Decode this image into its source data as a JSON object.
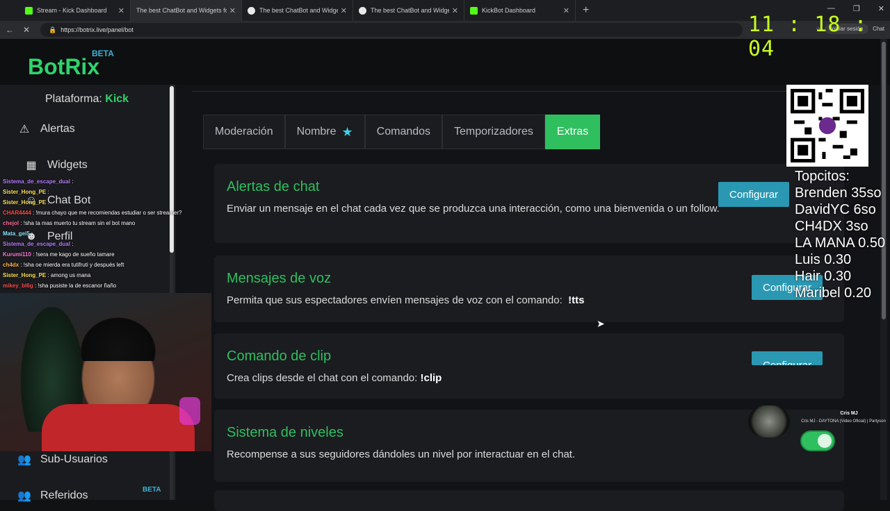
{
  "browser": {
    "tabs": [
      {
        "title": "Stream - Kick Dashboard",
        "color": "#53fc18"
      },
      {
        "title": "The best ChatBot and Widgets for",
        "color": "#e8e8e8"
      },
      {
        "title": "The best ChatBot and Widgets for",
        "color": "#e8e8e8"
      },
      {
        "title": "The best ChatBot and Widgets for",
        "color": "#e8e8e8"
      },
      {
        "title": "KickBot Dashboard",
        "color": "#53fc18"
      }
    ],
    "url": "https://botrix.live/panel/bot",
    "signin_label": "Iniciar sesión",
    "chat_label": "Chat"
  },
  "overlay": {
    "clock": "11 : 18 : 04",
    "topcitos": [
      "Topcitos:",
      "Brenden 35so",
      "DavidYC 6so",
      "CH4DX 3so",
      "LA MANA 0.50",
      "Luis 0.30",
      "Hair 0.30",
      "Maribel 0.20"
    ],
    "music": {
      "artist": "Cris MJ",
      "song": "Cris MJ - DAYTONA (Video Oficial) | Partyson"
    },
    "chat": [
      {
        "user": "Sistema_de_escape_dual",
        "msg": ":",
        "color": "#b57cff"
      },
      {
        "user": "Sister_Hong_PE",
        "msg": ":",
        "color": "#ffe35b"
      },
      {
        "user": "Sister_Hong_PE",
        "msg": ":",
        "color": "#ffe35b"
      },
      {
        "user": "CHAR4444",
        "msg": ": !mura chayo que me recomiendas estudiar o ser streamer?",
        "color": "#ff4b4b"
      },
      {
        "user": "chejol",
        "msg": ": !sha ta mas muerto tu stream sin el bot mano",
        "color": "#ff6a9a"
      },
      {
        "user": "Mata_gei5",
        "msg": ":",
        "color": "#8ee3ff"
      },
      {
        "user": "Sistema_de_escape_dual",
        "msg": ":",
        "color": "#b57cff"
      },
      {
        "user": "Kurumi110",
        "msg": ": !sera me kago de sueño tamare",
        "color": "#ff7ad9"
      },
      {
        "user": "ch4dx",
        "msg": ": !sha oe mierda era tutifruti y después left",
        "color": "#ffb347"
      },
      {
        "user": "Sister_Hong_PE",
        "msg": ": among us mana",
        "color": "#ffe35b"
      },
      {
        "user": "mikey_bl6g",
        "msg": ": !sha pusiste la de escanor ñaño",
        "color": "#ff4b4b"
      }
    ]
  },
  "app": {
    "logo": "BotRix",
    "logo_beta": "BETA",
    "platform_label": "Plataforma:",
    "platform_value": "Kick",
    "sidebar": [
      {
        "label": "Alertas",
        "icon": "warning-icon"
      },
      {
        "label": "Widgets",
        "icon": "widgets-icon"
      },
      {
        "label": "Chat Bot",
        "icon": "robot-icon"
      },
      {
        "label": "Perfil",
        "icon": "user-icon"
      },
      {
        "label": "Sub-Usuarios",
        "icon": "users-icon"
      },
      {
        "label": "Referidos",
        "icon": "users-icon"
      }
    ],
    "referidos_beta": "BETA",
    "tabs": [
      "Moderación",
      "Nombre",
      "Comandos",
      "Temporizadores",
      "Extras"
    ],
    "active_tab": "Extras",
    "cards": [
      {
        "title": "Alertas de chat",
        "desc": "Enviar un mensaje en el chat cada vez que se produzca una interacción, como una bienvenida o un follow.",
        "button": "Configurar"
      },
      {
        "title": "Mensajes de voz",
        "desc": "Permita que sus espectadores envíen mensajes de voz con el comando:",
        "command": "!tts",
        "button": "Configurar"
      },
      {
        "title": "Comando de clip",
        "desc": "Crea clips desde el chat con el comando:",
        "command": "!clip",
        "button": "Configurar"
      },
      {
        "title": "Sistema de niveles",
        "desc": "Recompense a sus seguidores dándoles un nivel por interactuar en el chat.",
        "toggle_on": true
      }
    ]
  },
  "colors": {
    "accent": "#2fbf5f",
    "button": "#2a98b3",
    "clock": "#c8ff1e"
  }
}
